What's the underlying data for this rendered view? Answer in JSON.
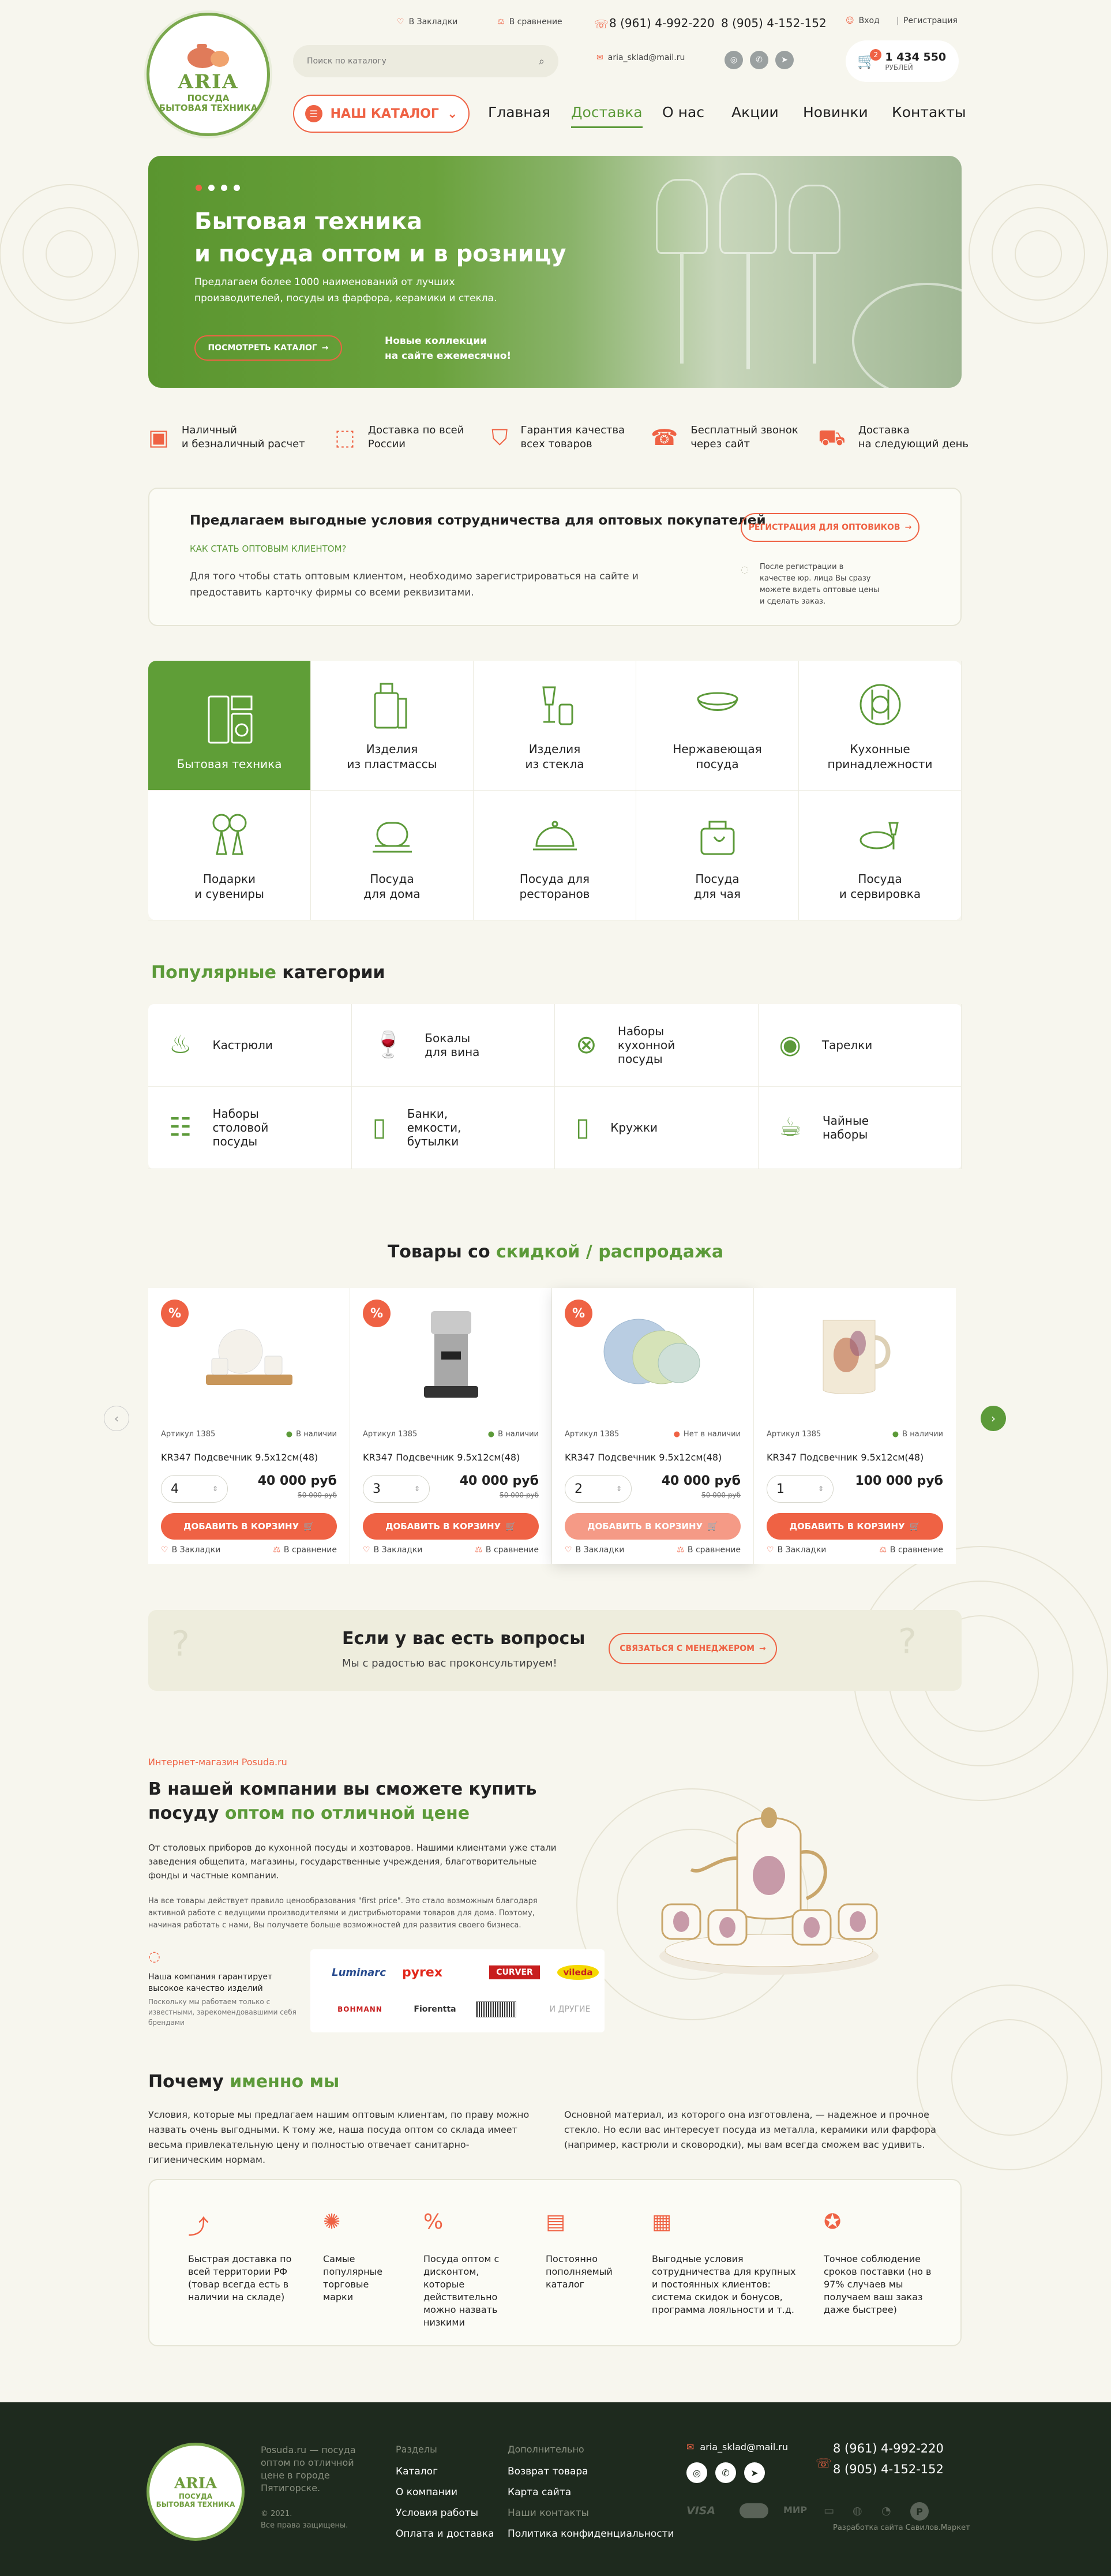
{
  "header": {
    "logo_word": "ARIA",
    "logo_sub1": "ПОСУДА",
    "logo_sub2": "БЫТОВАЯ ТЕХНИКА",
    "bookmarks": "В Закладки",
    "compare": "В сравнение",
    "search_placeholder": "Поиск по каталогу",
    "email": "aria_sklad@mail.ru",
    "phone1": "8 (961) 4-992-220",
    "phone2": "8 (905) 4-152-152",
    "login": "Вход",
    "register": "Регистрация",
    "cart_count": "2",
    "cart_sum": "1 434 550",
    "cart_currency": "РУБЛЕЙ",
    "catalog_button": "НАШ КАТАЛОГ",
    "nav": [
      "Главная",
      "Доставка",
      "О нас",
      "Акции",
      "Новинки",
      "Контакты"
    ]
  },
  "hero": {
    "title_line1": "Бытовая техника",
    "title_line2": "и посуда оптом и в розницу",
    "text": "Предлагаем более 1000 наименований от лучших производителей, посуды из фарфора, керамики и стекла.",
    "button": "ПОСМОТРЕТЬ КАТАЛОГ",
    "note_line1": "Новые коллекции",
    "note_line2": "на сайте ежемесячно!"
  },
  "features": [
    {
      "icon": "cash-icon",
      "l1": "Наличный",
      "l2": "и безналичный расчет"
    },
    {
      "icon": "delivery-box-icon",
      "l1": "Доставка по всей",
      "l2": "России"
    },
    {
      "icon": "shield-check-icon",
      "l1": "Гарантия качества",
      "l2": "всех товаров"
    },
    {
      "icon": "phone-call-icon",
      "l1": "Бесплатный звонок",
      "l2": "через сайт"
    },
    {
      "icon": "truck-icon",
      "l1": "Доставка",
      "l2": "на следующий день"
    }
  ],
  "wholesale": {
    "title": "Предлагаем выгодные условия сотрудничества для оптовых покупателей",
    "subtitle": "КАК СТАТЬ ОПТОВЫМ КЛИЕНТОМ?",
    "text": "Для того чтобы стать оптовым клиентом, необходимо зарегистрироваться на сайте и предоставить карточку фирмы со всеми реквизитами.",
    "button": "РЕГИСТРАЦИЯ ДЛЯ ОПТОВИКОВ",
    "note": "После регистрации в качестве юр. лица Вы сразу можете видеть оптовые цены и сделать заказ."
  },
  "categories": [
    {
      "l1": "Бытовая техника",
      "l2": "",
      "icon": "appliances-icon"
    },
    {
      "l1": "Изделия",
      "l2": "из пластмассы",
      "icon": "plastic-icon"
    },
    {
      "l1": "Изделия",
      "l2": "из стекла",
      "icon": "glass-icon"
    },
    {
      "l1": "Нержавеющая",
      "l2": "посуда",
      "icon": "bowl-icon"
    },
    {
      "l1": "Кухонные",
      "l2": "принадлежности",
      "icon": "cutlery-icon"
    },
    {
      "l1": "Подарки",
      "l2": "и сувениры",
      "icon": "gift-icon"
    },
    {
      "l1": "Посуда",
      "l2": "для дома",
      "icon": "home-dishes-icon"
    },
    {
      "l1": "Посуда для",
      "l2": "ресторанов",
      "icon": "cloche-icon"
    },
    {
      "l1": "Посуда",
      "l2": "для чая",
      "icon": "tea-icon"
    },
    {
      "l1": "Посуда",
      "l2": "и сервировка",
      "icon": "serving-icon"
    }
  ],
  "popular": {
    "title_green": "Популярные",
    "title_rest": "категории",
    "items": [
      {
        "l1": "Кастрюли",
        "l2": "",
        "l3": "",
        "icon": "pot-icon"
      },
      {
        "l1": "Бокалы",
        "l2": "для вина",
        "l3": "",
        "icon": "wine-glass-icon"
      },
      {
        "l1": "Наборы",
        "l2": "кухонной",
        "l3": "посуды",
        "icon": "kitchen-set-icon"
      },
      {
        "l1": "Тарелки",
        "l2": "",
        "l3": "",
        "icon": "plates-icon"
      },
      {
        "l1": "Наборы",
        "l2": "столовой",
        "l3": "посуды",
        "icon": "tableware-icon"
      },
      {
        "l1": "Банки,",
        "l2": "емкости,",
        "l3": "бутылки",
        "icon": "jar-icon"
      },
      {
        "l1": "Кружки",
        "l2": "",
        "l3": "",
        "icon": "mug-icon"
      },
      {
        "l1": "Чайные",
        "l2": "наборы",
        "l3": "",
        "icon": "teacup-icon"
      }
    ]
  },
  "sale": {
    "title_rest": "Товары со",
    "title_green": "скидкой",
    "title_sep": "/",
    "title_orange": "распродажа",
    "add_label": "ДОБАВИТЬ В КОРЗИНУ",
    "bookmark": "В Закладки",
    "compare": "В сравнение",
    "products": [
      {
        "art": "Артикул 1385",
        "stock": "В наличии",
        "name": "KR347 Подсвечник 9.5х12см(48)",
        "qty": "4",
        "price": "40 000 руб",
        "old": "50 000 руб",
        "pct": "%"
      },
      {
        "art": "Артикул 1385",
        "stock": "В наличии",
        "name": "KR347 Подсвечник 9.5х12см(48)",
        "qty": "3",
        "price": "40 000 руб",
        "old": "50 000 руб",
        "pct": "%"
      },
      {
        "art": "Артикул 1385",
        "stock": "Нет в наличии",
        "name": "KR347 Подсвечник 9.5х12см(48)",
        "qty": "2",
        "price": "40 000 руб",
        "old": "50 000 руб",
        "pct": "%"
      },
      {
        "art": "Артикул 1385",
        "stock": "В наличии",
        "name": "KR347 Подсвечник 9.5х12см(48)",
        "qty": "1",
        "price": "100 000 руб",
        "old": "",
        "pct": ""
      }
    ]
  },
  "questions": {
    "title": "Если у вас есть вопросы",
    "text": "Мы с радостью вас проконсультируем!",
    "button": "СВЯЗАТЬСЯ С МЕНЕДЖЕРОМ"
  },
  "about": {
    "overline": "Интернет-магазин Posuda.ru",
    "title_line1": "В нашей компании вы сможете купить",
    "title_line2_start": "посуду",
    "title_line2_green": "оптом по отличной цене",
    "p1": "От столовых приборов до кухонной посуды и хозтоваров. Нашими клиентами уже стали заведения общепита, магазины, государственные учреждения, благотворительные фонды и частные компании.",
    "p2": "На все товары действует правило ценообразования \"first price\". Это стало возможным благодаря активной работе с ведущими производителями и дистрибьюторами товаров для дома. Поэтому, начиная работать с нами, Вы получаете больше возможностей для развития своего бизнеса.",
    "guarantee_title": "Наша компания гарантирует высокое качество изделий",
    "guarantee_text": "Поскольку мы работаем только с известными, зарекомендовавшими себя брендами",
    "brands": [
      "Luminarc",
      "pyrex",
      "CURVER",
      "vileda",
      "BOHMANN",
      "Fiorentta",
      "",
      "И ДРУГИЕ"
    ]
  },
  "why": {
    "title_rest": "Почему",
    "title_green": "именно мы",
    "p1": "Условия, которые мы предлагаем нашим оптовым клиентам, по праву можно назвать очень выгодными. К тому же, наша посуда оптом со склада имеет весьма привлекательную цену и полностью отвечает санитарно-гигиеническим нормам.",
    "p2": "Основной материал, из которого она изготовлена, — надежное и прочное стекло. Но если вас интересует посуда из металла, керамики или фарфора (например, кастрюли и сковородки), мы вам всегда сможем вас удивить.",
    "items": [
      "Быстрая доставка по всей территории РФ (товар всегда есть в наличии на складе)",
      "Самые популярные торговые марки",
      "Посуда оптом с дисконтом, которые действительно можно назвать низкими",
      "Постоянно пополняемый каталог",
      "Выгодные условия сотрудничества для крупных и постоянных клиентов: система скидок и бонусов, программа лояльности и т.д.",
      "Точное соблюдение сроков поставки (но в 97% случаев мы получаем ваш заказ даже быстрее)"
    ]
  },
  "footer": {
    "about": "Posuda.ru — посуда оптом по отличной цене в городе Пятигорске.",
    "copyright": "© 2021.",
    "rights": "Все права защищены.",
    "sections_title": "Разделы",
    "sections": [
      "Каталог",
      "О компании",
      "Условия работы",
      "Оплата и доставка"
    ],
    "extra_title": "Дополнительно",
    "extra": [
      "Возврат товара",
      "Карта сайта",
      "Наши контакты",
      "Политика конфиденциальности"
    ],
    "email": "aria_sklad@mail.ru",
    "phone1": "8 (961) 4-992-220",
    "phone2": "8 (905) 4-152-152",
    "payments": [
      "VISA",
      "МИР"
    ],
    "dev": "Разработка сайта Савилов.Маркет"
  }
}
